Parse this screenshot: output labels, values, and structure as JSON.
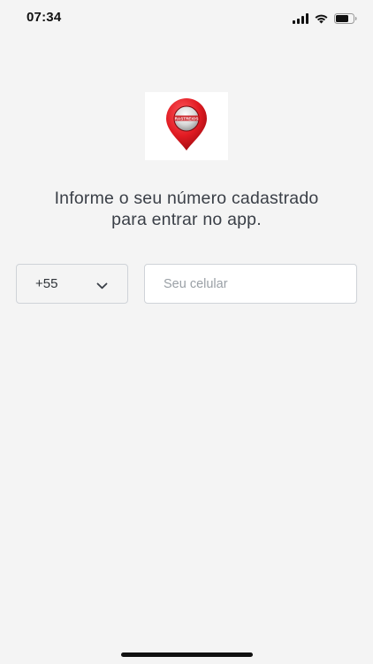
{
  "status_bar": {
    "time": "07:34",
    "icons": [
      "signal-icon",
      "wifi-icon",
      "battery-icon"
    ]
  },
  "logo": {
    "icon": "map-pin-icon",
    "text": "RASTREIOS",
    "pin_color": "#e11b22"
  },
  "login": {
    "instruction_line1": "Informe o seu número cadastrado",
    "instruction_line2": "para entrar no app.",
    "country_code": "+55",
    "phone_placeholder": "Seu celular",
    "phone_value": ""
  },
  "colors": {
    "background": "#f4f4f4",
    "text": "#3a3f47",
    "border": "#cfd3d8"
  }
}
